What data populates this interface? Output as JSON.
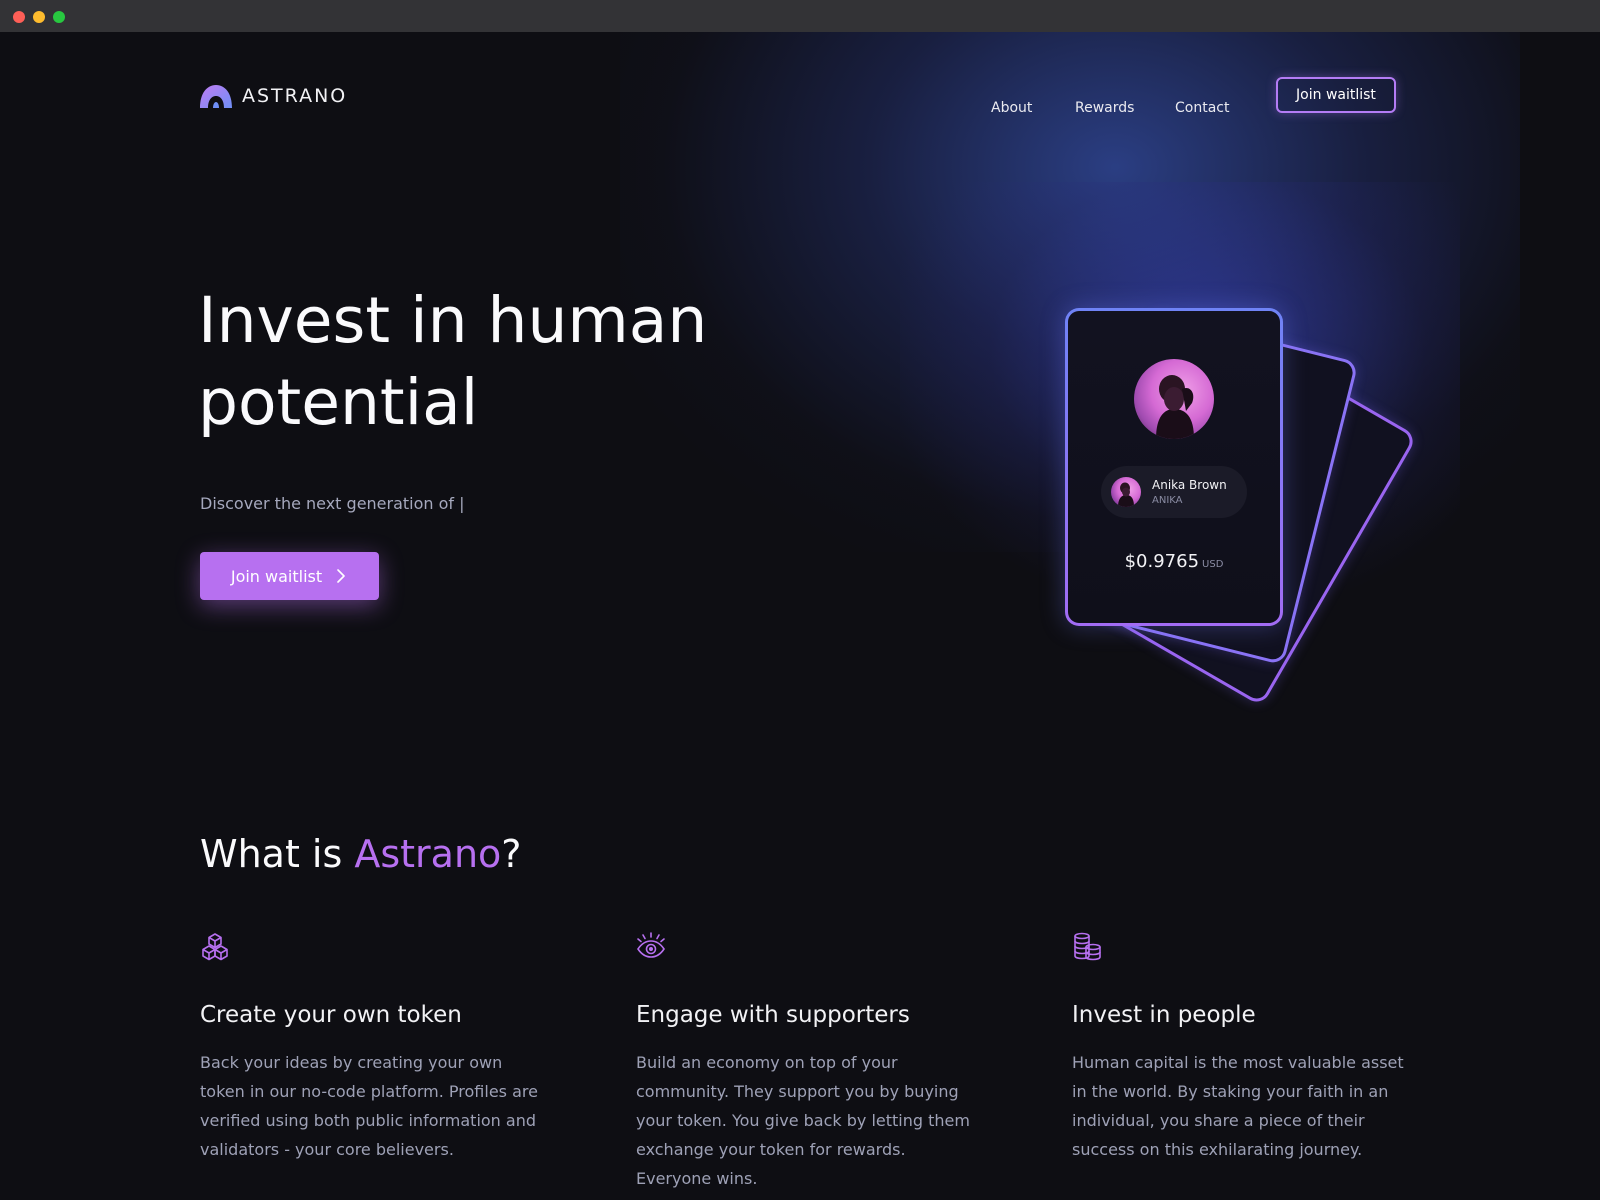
{
  "brand": {
    "name": "ASTRANO",
    "accent_color": "#b770f0"
  },
  "nav": {
    "items": [
      "About",
      "Rewards",
      "Contact"
    ],
    "cta_label": "Join waitlist"
  },
  "hero": {
    "title": "Invest in human potential",
    "subtitle": "Discover the next generation of |",
    "cta_label": "Join waitlist"
  },
  "card": {
    "name": "Anika Brown",
    "handle": "ANIKA",
    "price": "$0.9765",
    "currency": "USD"
  },
  "about": {
    "title_prefix": "What is ",
    "title_accent": "Astrano",
    "title_suffix": "?",
    "features": [
      {
        "icon": "cubes-icon",
        "title": "Create your own token",
        "body": "Back your ideas by creating your own token in our no-code platform. Profiles are verified using both public information and validators - your core believers."
      },
      {
        "icon": "eye-icon",
        "title": "Engage with supporters",
        "body": "Build an economy on top of your community. They support you by buying your token. You give back by letting them exchange your token for rewards. Everyone wins."
      },
      {
        "icon": "coins-icon",
        "title": "Invest in people",
        "body": "Human capital is the most valuable asset in the world. By staking your faith in an individual, you share a piece of their success on this exhilarating journey."
      }
    ]
  }
}
